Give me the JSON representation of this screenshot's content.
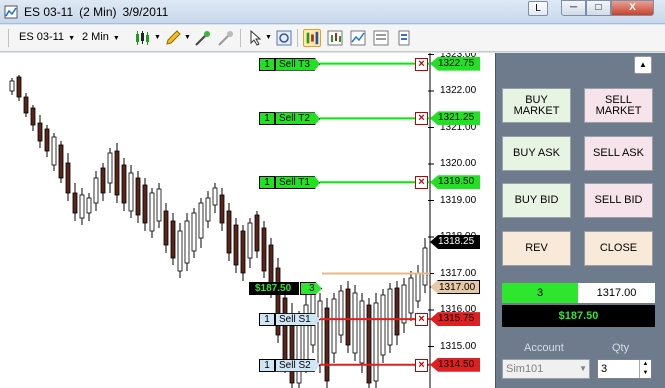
{
  "window": {
    "instrument": "ES 03-11",
    "interval": "(2 Min)",
    "date": "3/9/2011",
    "link_label": "L",
    "minimize_label": "─",
    "maximize_label": "□",
    "close_label": "X"
  },
  "toolbar": {
    "instrument": "ES 03-11",
    "interval": "2 Min",
    "dropdown_arrow": "▼"
  },
  "price_axis": [
    "1323.00",
    "1322.00",
    "1321.00",
    "1320.00",
    "1319.00",
    "1318.00",
    "1317.00",
    "1316.00",
    "1315.00"
  ],
  "orders": [
    {
      "qty": "1",
      "name": "Sell T3",
      "price": "1322.75",
      "kind": "target"
    },
    {
      "qty": "1",
      "name": "Sell T2",
      "price": "1321.25",
      "kind": "target"
    },
    {
      "qty": "1",
      "name": "Sell T1",
      "price": "1319.50",
      "kind": "target"
    },
    {
      "qty": "1",
      "name": "Sell S1",
      "price": "1315.75",
      "kind": "stop"
    },
    {
      "qty": "1",
      "name": "Sell S2",
      "price": "1314.50",
      "kind": "stop"
    }
  ],
  "last_price": "1318.25",
  "position": {
    "pnl": "$187.50",
    "qty": "3",
    "avg_price": "1317.00"
  },
  "panel": {
    "buttons": [
      {
        "label": "BUY MARKET",
        "side": "buy"
      },
      {
        "label": "SELL MARKET",
        "side": "sell"
      },
      {
        "label": "BUY ASK",
        "side": "buy"
      },
      {
        "label": "SELL ASK",
        "side": "sell"
      },
      {
        "label": "BUY BID",
        "side": "buy"
      },
      {
        "label": "SELL BID",
        "side": "sell"
      },
      {
        "label": "REV",
        "side": "neutral"
      },
      {
        "label": "CLOSE",
        "side": "neutral"
      }
    ],
    "position_qty": "3",
    "position_price": "1317.00",
    "pnl": "$187.50",
    "account_label": "Account",
    "qty_label": "Qty",
    "account_value": "Sim101",
    "qty_value": "3"
  },
  "colors": {
    "target": "#00ee00",
    "stop": "#e02020",
    "position_line": "#e8b88a",
    "pnl_text": "#2ee62e",
    "panel_bg": "#6d7b8d"
  }
}
